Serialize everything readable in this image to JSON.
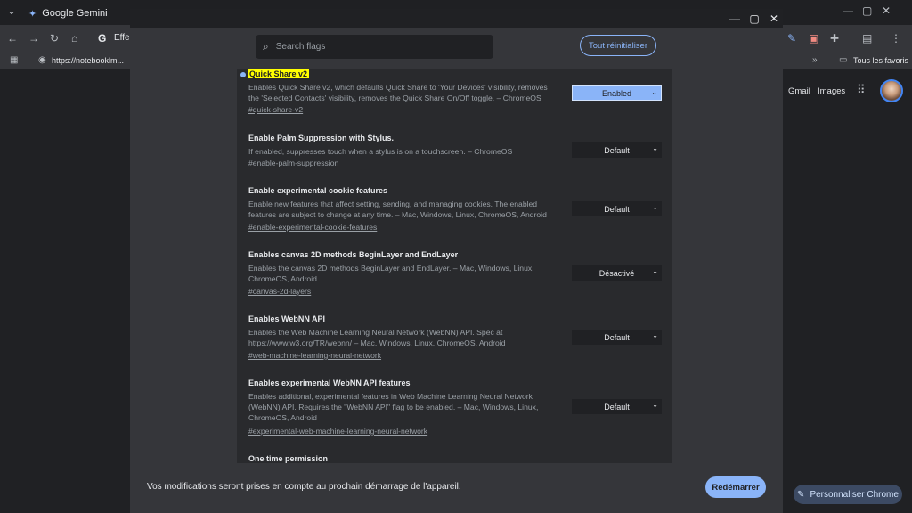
{
  "browser": {
    "tab_title": "Google Gemini",
    "omnibox_partial": "Effe",
    "bookmark_url": "https://notebooklm...",
    "bookmarks_folder": "Tous les favoris",
    "link_gmail": "Gmail",
    "link_images": "Images",
    "customize_label": "Personnaliser Chrome"
  },
  "flags": {
    "search_placeholder": "Search flags",
    "reset_all_label": "Tout réinitialiser",
    "items": [
      {
        "title": "Quick Share v2",
        "description": "Enables Quick Share v2, which defaults Quick Share to 'Your Devices' visibility, removes the 'Selected Contacts' visibility, removes the Quick Share On/Off toggle. – ChromeOS",
        "link": "#quick-share-v2",
        "value": "Enabled"
      },
      {
        "title": "Enable Palm Suppression with Stylus.",
        "description": "If enabled, suppresses touch when a stylus is on a touchscreen. – ChromeOS",
        "link": "#enable-palm-suppression",
        "value": "Default"
      },
      {
        "title": "Enable experimental cookie features",
        "description": "Enable new features that affect setting, sending, and managing cookies. The enabled features are subject to change at any time. – Mac, Windows, Linux, ChromeOS, Android",
        "link": "#enable-experimental-cookie-features",
        "value": "Default"
      },
      {
        "title": "Enables canvas 2D methods BeginLayer and EndLayer",
        "description": "Enables the canvas 2D methods BeginLayer and EndLayer. – Mac, Windows, Linux, ChromeOS, Android",
        "link": "#canvas-2d-layers",
        "value": "Désactivé"
      },
      {
        "title": "Enables WebNN API",
        "description": "Enables the Web Machine Learning Neural Network (WebNN) API. Spec at https://www.w3.org/TR/webnn/ – Mac, Windows, Linux, ChromeOS, Android",
        "link": "#web-machine-learning-neural-network",
        "value": "Default"
      },
      {
        "title": "Enables experimental WebNN API features",
        "description": "Enables additional, experimental features in Web Machine Learning Neural Network (WebNN) API. Requires the \"WebNN API\" flag to be enabled. – Mac, Windows, Linux, ChromeOS, Android",
        "link": "#experimental-web-machine-learning-neural-network",
        "value": "Default"
      },
      {
        "title": "One time permission",
        "description": "",
        "link": "",
        "value": ""
      }
    ],
    "footer_message": "Vos modifications seront prises en compte au prochain démarrage de l'appareil.",
    "restart_label": "Redémarrer"
  },
  "icons": {
    "search": "search-icon",
    "minimize": "minimize-icon",
    "maximize": "maximize-icon",
    "close": "close-icon",
    "chevron": "chevron-down-icon",
    "pencil": "pencil-icon"
  },
  "colors": {
    "accent": "#8ab4f8",
    "highlight": "#ffff00"
  }
}
